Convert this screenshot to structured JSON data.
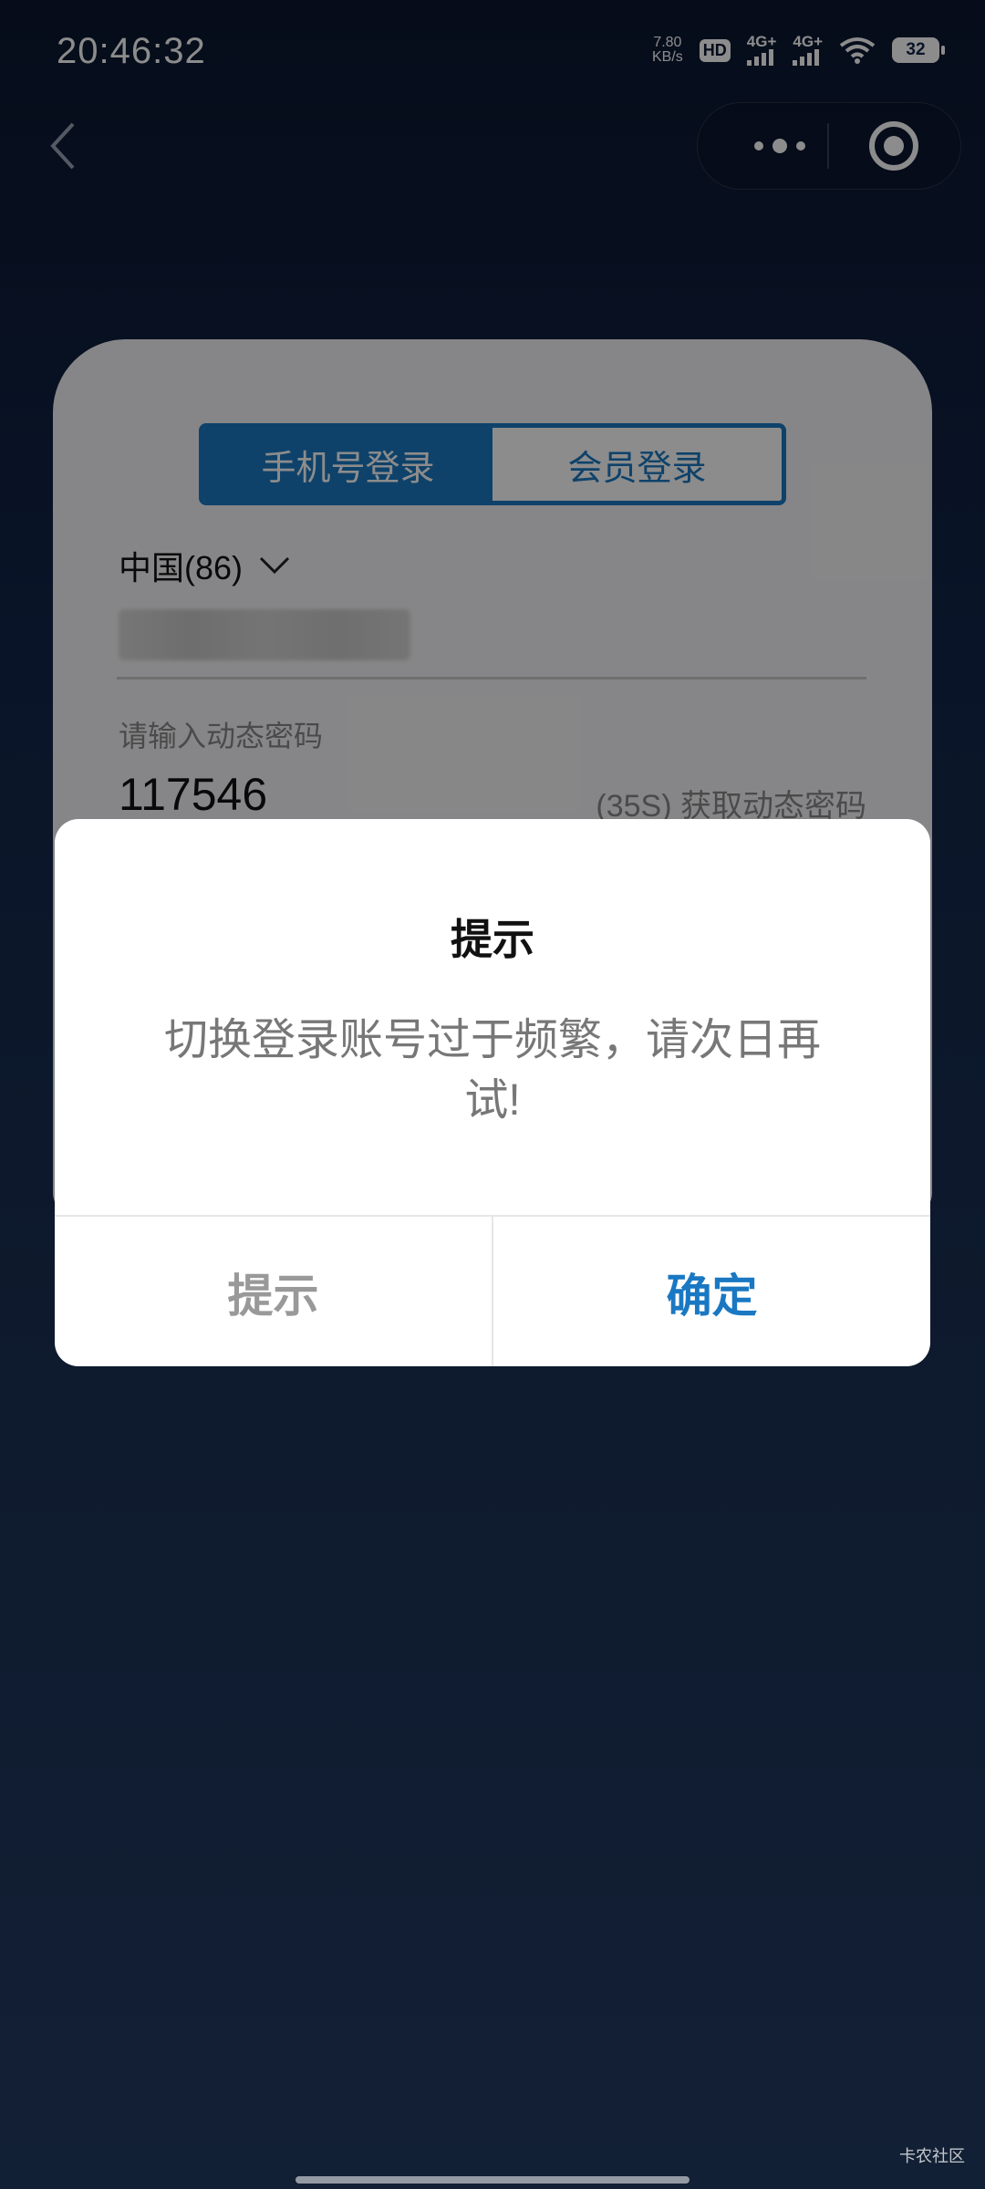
{
  "status_bar": {
    "time": "20:46:32",
    "net_speed": "7.80",
    "net_unit": "KB/s",
    "hd": "HD",
    "sim1": "4G+",
    "sim2": "4G+",
    "battery": "32"
  },
  "login": {
    "tab_phone": "手机号登录",
    "tab_member": "会员登录",
    "country": "中国(86)",
    "otp_label": "请输入动态密码",
    "otp_value": "117546",
    "otp_get": "(35S) 获取动态密码"
  },
  "dialog": {
    "title": "提示",
    "message": "切换登录账号过于频繁，请次日再试!",
    "left_button": "提示",
    "right_button": "确定"
  },
  "watermark": "卡农社区",
  "colors": {
    "accent": "#1a78c2",
    "bg_top": "#0b1730",
    "bg_bottom": "#223b62"
  }
}
